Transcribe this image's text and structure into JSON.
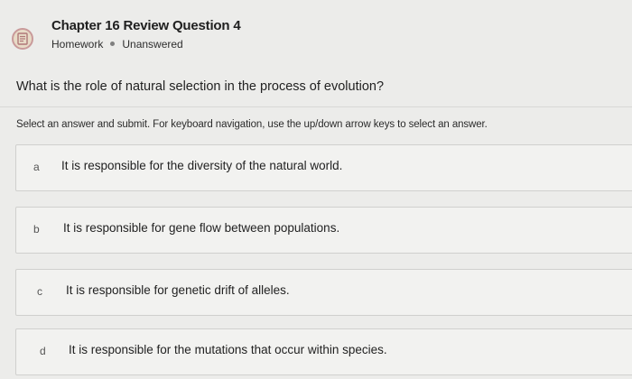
{
  "header": {
    "title": "Chapter 16 Review Question 4",
    "category": "Homework",
    "status": "Unanswered",
    "icon": "homework-icon"
  },
  "question": {
    "text": "What is the role of natural selection in the process of evolution?"
  },
  "instructions": "Select an answer and submit. For keyboard navigation, use the up/down arrow keys to select an answer.",
  "options": [
    {
      "letter": "a",
      "text": "It is responsible for the diversity of the natural world."
    },
    {
      "letter": "b",
      "text": "It is responsible for gene flow between populations."
    },
    {
      "letter": "c",
      "text": "It is responsible for genetic drift of alleles."
    },
    {
      "letter": "d",
      "text": "It is responsible for the mutations that occur within species."
    }
  ],
  "colors": {
    "background": "#ececea",
    "icon_fill": "#e8dbc7",
    "icon_border": "#c99a9a"
  }
}
